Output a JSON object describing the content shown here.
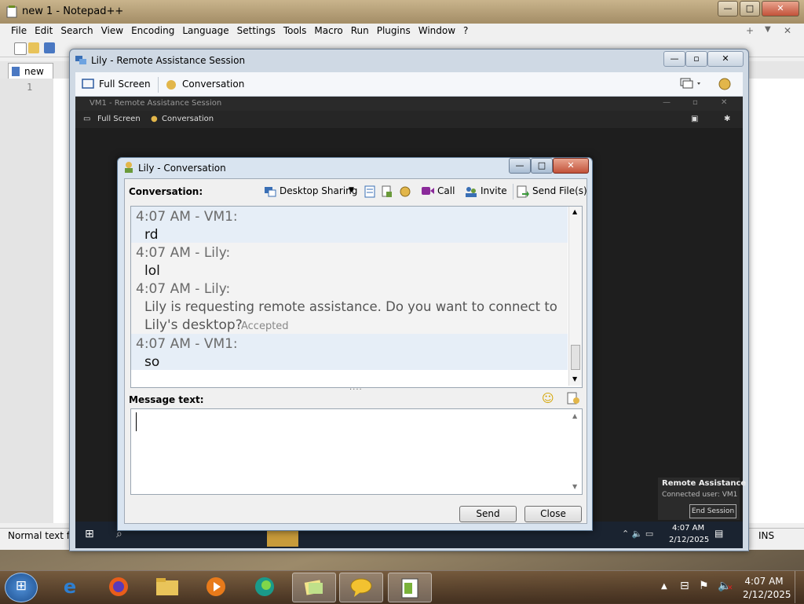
{
  "notepad": {
    "title": "new 1 - Notepad++",
    "menu": [
      "File",
      "Edit",
      "Search",
      "View",
      "Encoding",
      "Language",
      "Settings",
      "Tools",
      "Macro",
      "Run",
      "Plugins",
      "Window",
      "?"
    ],
    "right_controls": [
      "+",
      "▼",
      "✕"
    ],
    "tab": "new 1",
    "line_number": "1",
    "status_left": "Normal text fil",
    "status_mode": "INS"
  },
  "remote_assistance": {
    "title": "Lily - Remote Assistance Session",
    "toolbar": {
      "full_screen": "Full Screen",
      "conversation": "Conversation"
    },
    "vm_session": {
      "title": "VM1 - Remote Assistance Session",
      "full_screen": "Full Screen",
      "conversation": "Conversation",
      "tray_time": "4:07 AM",
      "tray_date": "2/12/2025"
    }
  },
  "conversation": {
    "title": "Lily - Conversation",
    "label": "Conversation:",
    "toolbar": {
      "desktop_sharing": "Desktop Sharing",
      "call": "Call",
      "invite": "Invite",
      "send_files": "Send File(s)"
    },
    "messages": [
      {
        "time": "4:07 AM - VM1:",
        "text": "rd",
        "highlight": true
      },
      {
        "time": "4:07 AM - Lily:",
        "text": "lol",
        "highlight": false
      },
      {
        "time": "4:07 AM - Lily:",
        "text": "Lily is requesting remote assistance. Do you want to connect to",
        "text2": "Lily's desktop?",
        "status": "Accepted",
        "highlight": false
      },
      {
        "time": "4:07 AM - VM1:",
        "text": "so",
        "highlight": true
      }
    ],
    "message_label": "Message text:",
    "send": "Send",
    "close": "Close"
  },
  "ra_notification": {
    "title": "Remote Assistance",
    "connected": "Connected user: VM1",
    "end_session": "End Session"
  },
  "taskbar": {
    "time": "4:07 AM",
    "date": "2/12/2025"
  }
}
